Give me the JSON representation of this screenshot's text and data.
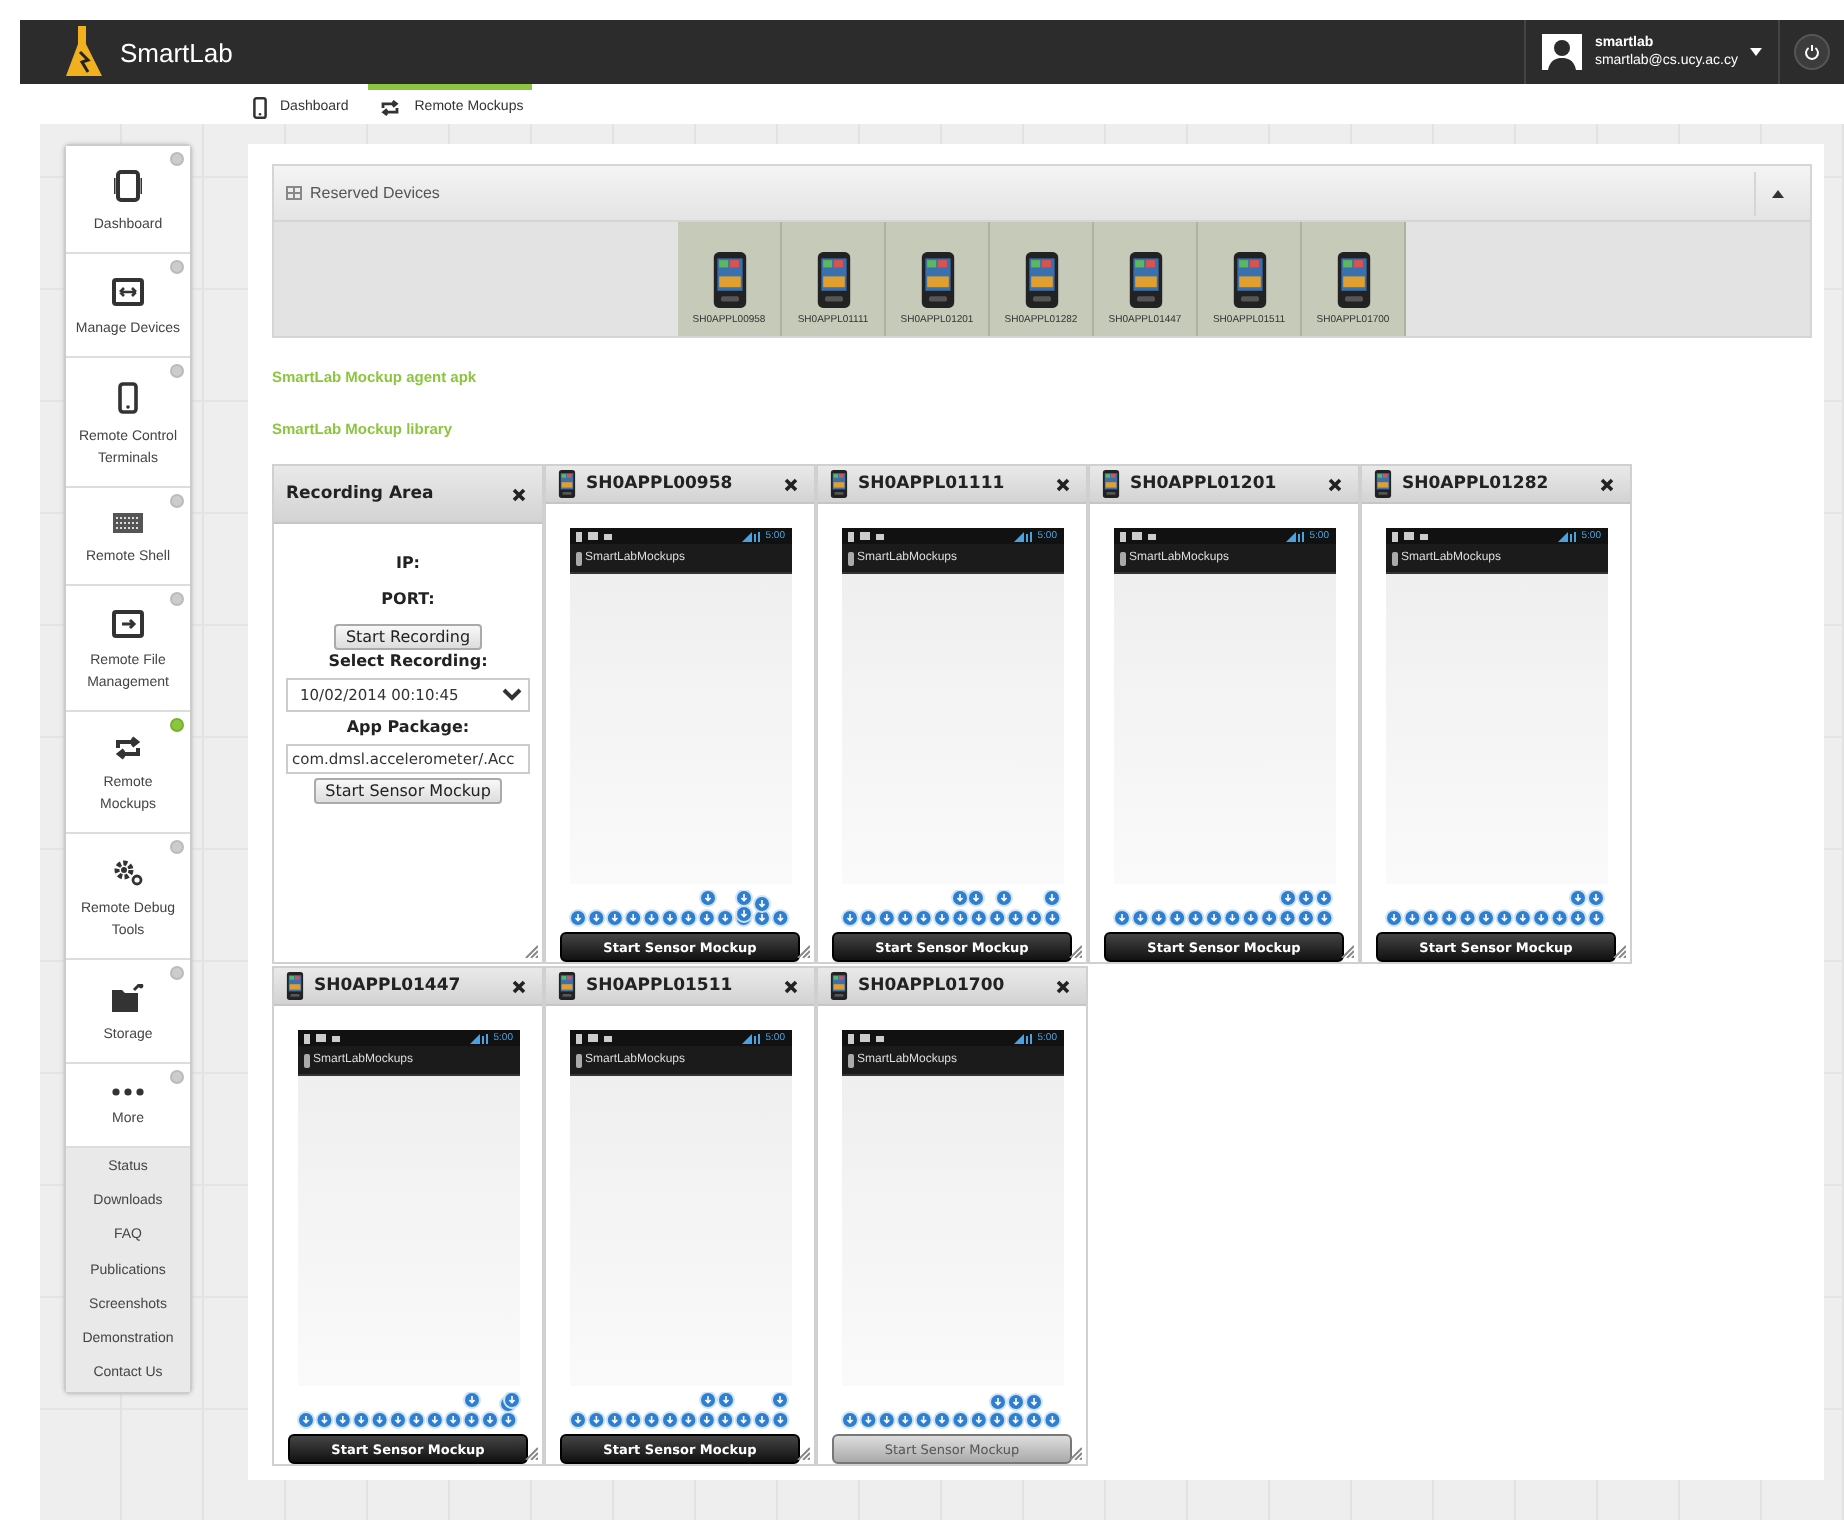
{
  "header": {
    "brand": "SmartLab",
    "user_name": "smartlab",
    "user_email": "smartlab@cs.ucy.ac.cy"
  },
  "nav_tabs": [
    {
      "label": "Dashboard",
      "selected": false
    },
    {
      "label": "Remote Mockups",
      "selected": true
    }
  ],
  "sidebar": {
    "items": [
      {
        "label": "Dashboard",
        "selected": false
      },
      {
        "label": "Manage Devices",
        "selected": false
      },
      {
        "label": "Remote Control Terminals",
        "selected": false
      },
      {
        "label": "Remote Shell",
        "selected": false
      },
      {
        "label": "Remote File Management",
        "selected": false
      },
      {
        "label": "Remote Mockups",
        "selected": true
      },
      {
        "label": "Remote Debug Tools",
        "selected": false
      },
      {
        "label": "Storage",
        "selected": false
      },
      {
        "label": "More",
        "selected": false
      }
    ],
    "links": [
      "Status",
      "Downloads",
      "FAQ",
      "Publications",
      "Screenshots",
      "Demonstration",
      "Contact Us"
    ]
  },
  "reserved_devices": {
    "title": "Reserved Devices",
    "expanded": true,
    "devices": [
      "SH0APPL00958",
      "SH0APPL01111",
      "SH0APPL01201",
      "SH0APPL01282",
      "SH0APPL01447",
      "SH0APPL01511",
      "SH0APPL01700"
    ]
  },
  "links": [
    "SmartLab Mockup agent apk",
    "SmartLab Mockup library"
  ],
  "recording_area": {
    "title": "Recording Area",
    "ip_label": "IP:",
    "port_label": "PORT:",
    "record_button": "Start Recording",
    "select_label": "Select Recording:",
    "recording": "10/02/2014 00:10:45",
    "package_label": "App Package:",
    "package": "com.dmsl.accelerometer/.Acc",
    "start_button": "Start Sensor Mockup"
  },
  "device_panels": [
    {
      "title": "SH0APPL00958",
      "time": "5:00",
      "app_title": "SmartLabMockups",
      "button": "Start Sensor Mockup",
      "disabled": false
    },
    {
      "title": "SH0APPL01111",
      "time": "5:00",
      "app_title": "SmartLabMockups",
      "button": "Start Sensor Mockup",
      "disabled": false
    },
    {
      "title": "SH0APPL01201",
      "time": "5:00",
      "app_title": "SmartLabMockups",
      "button": "Start Sensor Mockup",
      "disabled": false
    },
    {
      "title": "SH0APPL01282",
      "time": "5:00",
      "app_title": "SmartLabMockups",
      "button": "Start Sensor Mockup",
      "disabled": false
    },
    {
      "title": "SH0APPL01447",
      "time": "5:00",
      "app_title": "SmartLabMockups",
      "button": "Start Sensor Mockup",
      "disabled": false
    },
    {
      "title": "SH0APPL01511",
      "time": "5:00",
      "app_title": "SmartLabMockups",
      "button": "Start Sensor Mockup",
      "disabled": false
    },
    {
      "title": "SH0APPL01700",
      "time": "5:00",
      "app_title": "SmartLabMockups",
      "button": "Start Sensor Mockup",
      "disabled": true
    }
  ]
}
